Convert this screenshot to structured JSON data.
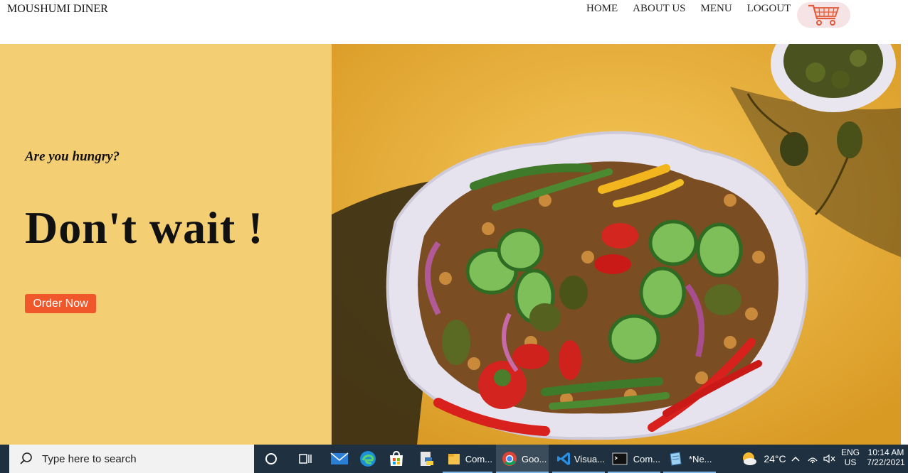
{
  "nav": {
    "brand": "MOUSHUMI DINER",
    "links": [
      "HOME",
      "ABOUT US",
      "MENU",
      "LOGOUT"
    ],
    "cart_icon": "shopping-cart-icon"
  },
  "hero": {
    "tagline": "Are you hungry?",
    "headline": "Don't wait !",
    "cta_label": "Order Now",
    "image": "salad-platter-photo",
    "colors": {
      "left_bg": "#f4ce73",
      "button": "#f0572a"
    }
  },
  "taskbar": {
    "search_placeholder": "Type here to search",
    "apps": [
      {
        "label": "Com...",
        "icon": "file-explorer-icon"
      },
      {
        "label": "Goo...",
        "icon": "chrome-icon"
      },
      {
        "label": "Visua...",
        "icon": "vscode-icon"
      },
      {
        "label": "Com...",
        "icon": "command-prompt-icon"
      },
      {
        "label": "*Ne...",
        "icon": "notepad-icon"
      }
    ],
    "weather": "24°C",
    "language": "ENG",
    "region": "US",
    "time": "10:14 AM",
    "date": "7/22/2021"
  }
}
